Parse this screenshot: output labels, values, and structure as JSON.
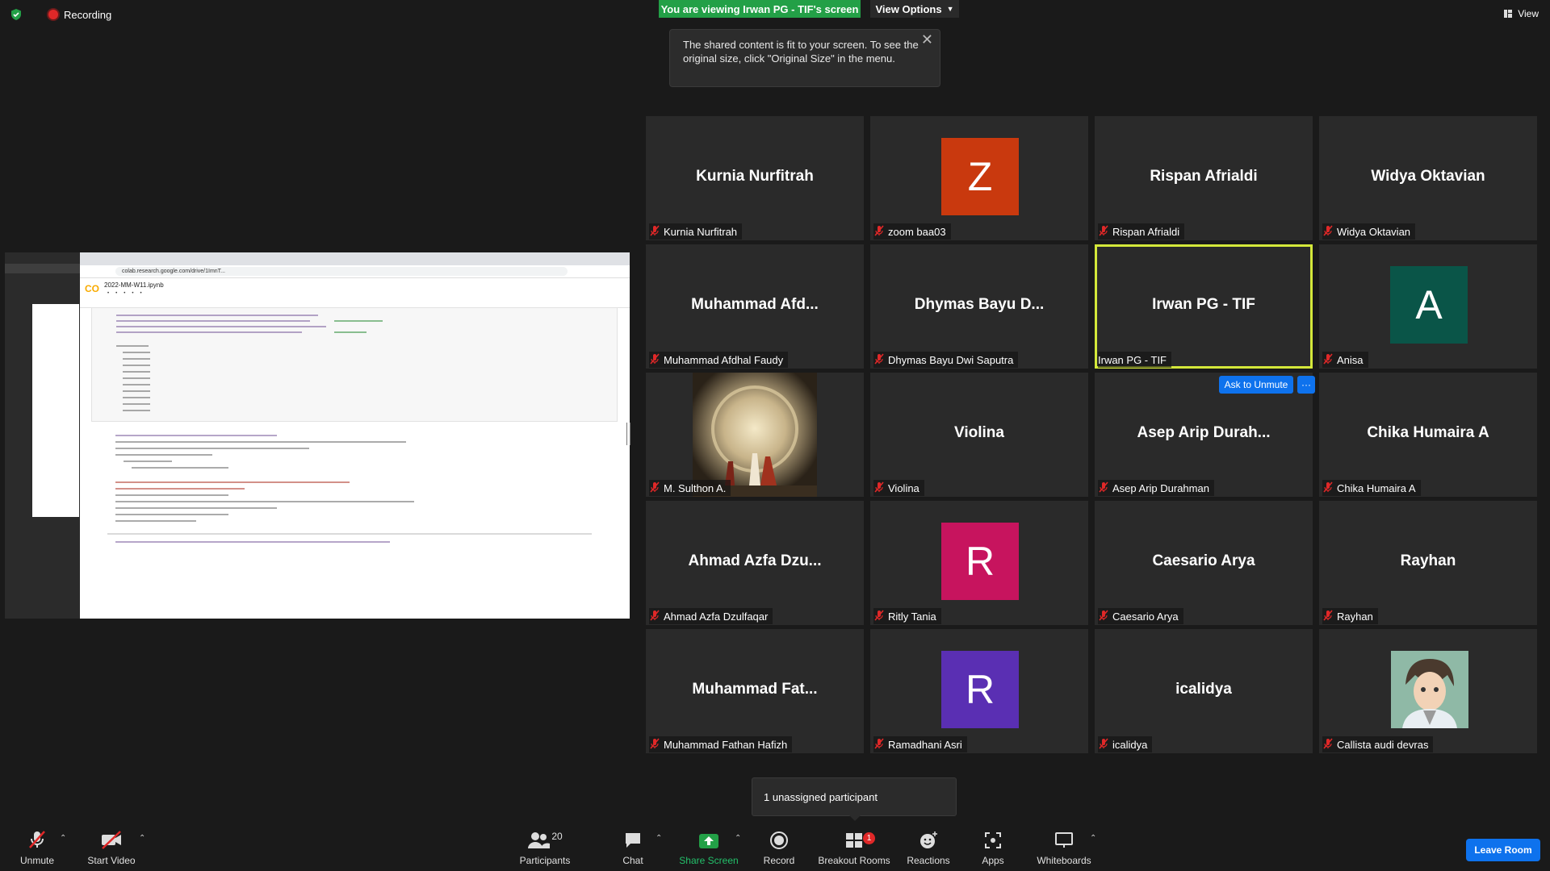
{
  "top": {
    "recording_label": "Recording",
    "viewing_banner": "You are viewing Irwan PG - TIF's screen",
    "view_options_label": "View Options",
    "tooltip_text": "The shared content is fit to your screen. To see the original size, click \"Original Size\" in the menu.",
    "view_label": "View"
  },
  "shared_screen": {
    "notebook_title": "2022-MM-W11.ipynb",
    "url": "colab.research.google.com/drive/1ImnT..."
  },
  "tiles": [
    {
      "name": "Kurnia Nurfitrah",
      "label": "Kurnia Nurfitrah",
      "type": "name",
      "muted": true
    },
    {
      "name": "Z",
      "label": "zoom baa03",
      "type": "avatar",
      "color": "#c9390e",
      "muted": true
    },
    {
      "name": "Rispan Afrialdi",
      "label": "Rispan Afrialdi",
      "type": "name",
      "muted": true
    },
    {
      "name": "Widya Oktavian",
      "label": "Widya Oktavian",
      "type": "name",
      "muted": true
    },
    {
      "name": "Muhammad  Afd...",
      "label": "Muhammad Afdhal Faudy",
      "type": "name",
      "muted": true
    },
    {
      "name": "Dhymas Bayu D...",
      "label": "Dhymas Bayu Dwi Saputra",
      "type": "name",
      "muted": true
    },
    {
      "name": "Irwan PG - TIF",
      "label": "Irwan PG - TIF",
      "type": "name",
      "muted": false,
      "active": true
    },
    {
      "name": "A",
      "label": "Anisa",
      "type": "avatar",
      "color": "#0a5548",
      "muted": true
    },
    {
      "name": "",
      "label": "M. Sulthon A.",
      "type": "photo-portal",
      "muted": true
    },
    {
      "name": "Violina",
      "label": "Violina",
      "type": "name",
      "muted": true
    },
    {
      "name": "Asep Arip Durah...",
      "label": "Asep Arip Durahman",
      "type": "name",
      "muted": true
    },
    {
      "name": "Chika Humaira A",
      "label": "Chika Humaira A",
      "type": "name",
      "muted": true
    },
    {
      "name": "Ahmad Azfa Dzu...",
      "label": "Ahmad Azfa Dzulfaqar",
      "type": "name",
      "muted": true
    },
    {
      "name": "R",
      "label": "Ritly Tania",
      "type": "avatar",
      "color": "#c7145e",
      "muted": true
    },
    {
      "name": "Caesario Arya",
      "label": "Caesario Arya",
      "type": "name",
      "muted": true
    },
    {
      "name": "Rayhan",
      "label": "Rayhan",
      "type": "name",
      "muted": true
    },
    {
      "name": "Muhammad  Fat...",
      "label": "Muhammad Fathan Hafizh",
      "type": "name",
      "muted": true
    },
    {
      "name": "R",
      "label": "Ramadhani Asri",
      "type": "avatar",
      "color": "#5a2fb3",
      "muted": true
    },
    {
      "name": "icalidya",
      "label": "icalidya",
      "type": "name",
      "muted": true
    },
    {
      "name": "",
      "label": "Callista audi devras",
      "type": "photo-anime",
      "muted": true
    }
  ],
  "ask_unmute_label": "Ask to Unmute",
  "more_label": "···",
  "unassigned_label": "1 unassigned participant",
  "toolbar": {
    "unmute": "Unmute",
    "start_video": "Start Video",
    "participants": "Participants",
    "participants_count": "20",
    "chat": "Chat",
    "share_screen": "Share Screen",
    "record": "Record",
    "breakout_rooms": "Breakout Rooms",
    "breakout_badge": "1",
    "reactions": "Reactions",
    "apps": "Apps",
    "whiteboards": "Whiteboards",
    "leave_room": "Leave Room"
  },
  "colors": {
    "share_green": "#23a047",
    "zoom_blue": "#0e72ed",
    "active_speaker": "#d4e83a",
    "mute_red": "#e02828"
  }
}
